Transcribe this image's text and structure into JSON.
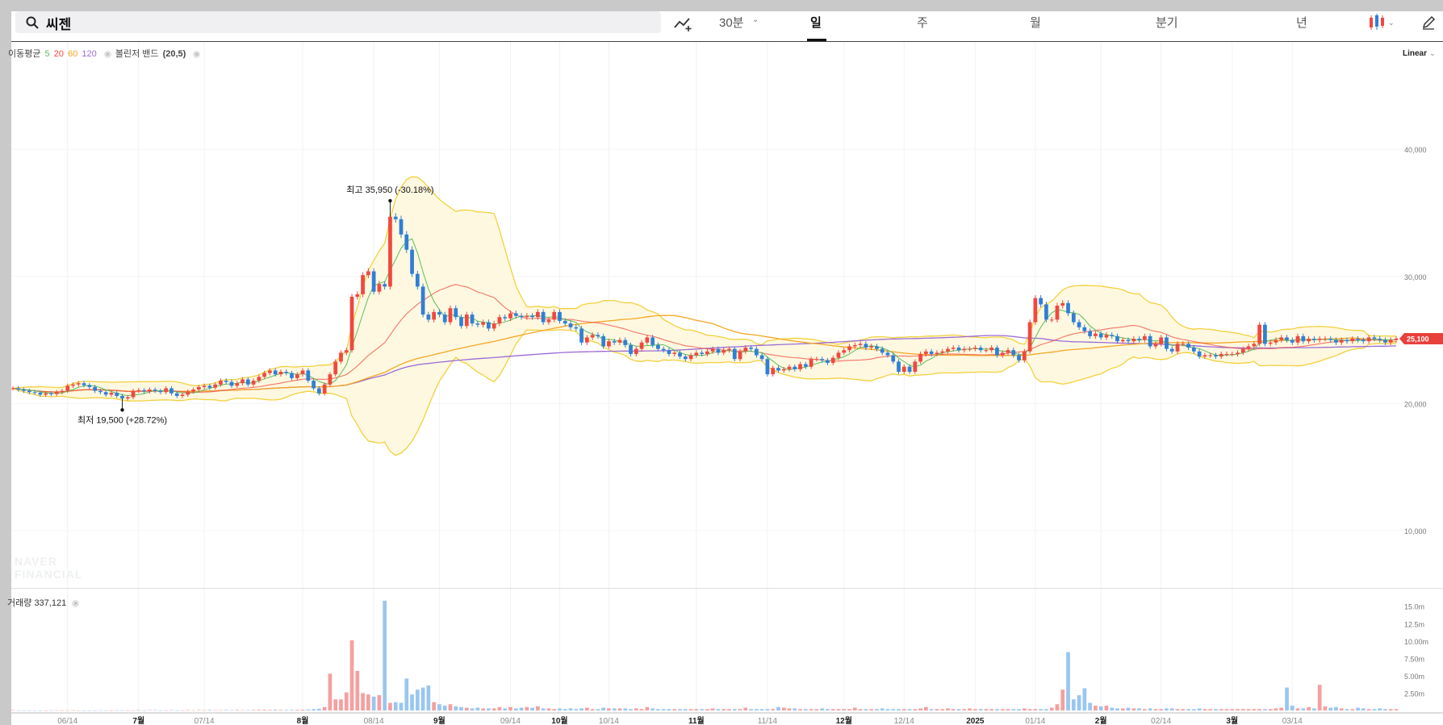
{
  "search": {
    "query": "씨젠"
  },
  "toolbar": {
    "intervals": [
      "30분",
      "일",
      "주",
      "월",
      "분기",
      "년"
    ],
    "active_interval": "일"
  },
  "indicators": {
    "ma_label": "이동평균",
    "ma_periods": [
      "5",
      "20",
      "60",
      "120"
    ],
    "bb_label": "볼린저 밴드",
    "bb_params": "(20,5)"
  },
  "scale_label": "Linear",
  "watermark": [
    "NAVER",
    "FINANCIAL"
  ],
  "volume": {
    "label": "거래량",
    "value": "337,121"
  },
  "colors": {
    "up": "#f0483e",
    "down": "#2f7fd6",
    "up_vol": "#f4a0a0",
    "down_vol": "#9ac6f0",
    "ma5": "#5bbf5b",
    "ma20": "#f0483e",
    "ma60": "#f5a623",
    "ma120": "#9b6bd6",
    "bb_line": "#f2d13e",
    "bb_fill": "#fff8e0",
    "price_tag": "#e8413c"
  },
  "chart_data": [
    {
      "type": "candlestick",
      "x_labels": [
        "06/14",
        "7월",
        "07/14",
        "8월",
        "08/14",
        "9월",
        "09/14",
        "10월",
        "10/14",
        "11월",
        "11/14",
        "12월",
        "12/14",
        "2025",
        "01/14",
        "2월",
        "02/14",
        "3월",
        "03/14"
      ],
      "y_ticks": [
        "10,000",
        "20,000",
        "30,000",
        "40,000"
      ],
      "ylim": [
        5500,
        48000
      ],
      "last_price": "25,100",
      "annotations": {
        "high": {
          "label": "최고 35,950 (-30.18%)",
          "value": 35950
        },
        "low": {
          "label": "최저 19,500 (+28.72%)",
          "value": 19500
        }
      },
      "close": [
        21200,
        21100,
        21000,
        20900,
        20850,
        20700,
        20800,
        20750,
        20900,
        21000,
        21400,
        21500,
        21600,
        21450,
        21300,
        21000,
        20900,
        20700,
        20850,
        20600,
        20400,
        20500,
        21000,
        21050,
        20950,
        21100,
        21000,
        20900,
        21200,
        20800,
        20600,
        20700,
        20950,
        21100,
        21300,
        21400,
        21250,
        21500,
        21800,
        21700,
        21400,
        21600,
        21900,
        21500,
        21800,
        22100,
        22400,
        22600,
        22300,
        22500,
        22400,
        22000,
        22300,
        22600,
        21800,
        21200,
        20800,
        21500,
        22300,
        23300,
        24000,
        24200,
        28400,
        28600,
        30100,
        30400,
        28800,
        29400,
        29200,
        34700,
        34500,
        33300,
        32100,
        30200,
        29200,
        27000,
        26600,
        27200,
        27000,
        26400,
        27500,
        26800,
        26100,
        27000,
        26300,
        26200,
        26400,
        25900,
        26300,
        26800,
        26700,
        27100,
        26900,
        26800,
        26900,
        26800,
        27200,
        26400,
        26600,
        27200,
        26500,
        26300,
        26000,
        25900,
        24800,
        25200,
        25400,
        25300,
        24500,
        24900,
        24800,
        25000,
        24600,
        23900,
        24300,
        24800,
        25200,
        24600,
        24300,
        24200,
        23900,
        24000,
        23700,
        23500,
        23800,
        24000,
        23900,
        24100,
        24300,
        24000,
        24200,
        24300,
        23500,
        24100,
        24400,
        24300,
        23800,
        23500,
        22300,
        22800,
        22600,
        22700,
        22900,
        22700,
        23100,
        22900,
        23500,
        23500,
        23400,
        23200,
        23600,
        24000,
        24200,
        24500,
        24600,
        24700,
        24400,
        24500,
        24300,
        24000,
        23800,
        23300,
        22500,
        22900,
        22500,
        23300,
        23900,
        24100,
        23900,
        24000,
        24100,
        24300,
        24400,
        24200,
        24300,
        24300,
        24400,
        24200,
        24200,
        24400,
        23800,
        24000,
        24200,
        23800,
        23400,
        24100,
        26400,
        28300,
        27800,
        26600,
        26600,
        27700,
        27900,
        27100,
        26400,
        26000,
        25700,
        25300,
        25500,
        25200,
        25400,
        25300,
        24900,
        25000,
        24900,
        25100,
        25000,
        25300,
        24500,
        24700,
        25200,
        24300,
        24100,
        24700,
        24700,
        24400,
        24100,
        23700,
        23800,
        23800,
        23700,
        23900,
        23900,
        23900,
        24000,
        24300,
        24500,
        24700,
        26200,
        24700,
        24800,
        25000,
        25200,
        25000,
        24800,
        25300,
        24900,
        25100,
        25000,
        25100,
        25100,
        25000,
        24800,
        25000,
        24900,
        25100,
        25000,
        24900,
        25200,
        25100,
        25000,
        24800,
        25000,
        25100
      ],
      "volume": [
        0.05,
        0.02,
        0.03,
        0.02,
        0.02,
        0.01,
        0.02,
        0.03,
        0.05,
        0.03,
        0.03,
        0.05,
        0.02,
        0.02,
        0.01,
        0.02,
        0.03,
        0.02,
        0.02,
        0.03,
        0.03,
        0.02,
        0.03,
        0.05,
        0.02,
        0.05,
        0.05,
        0.02,
        0.03,
        0.05,
        0.02,
        0.03,
        0.06,
        0.03,
        0.06,
        0.04,
        0.08,
        0.05,
        0.04,
        0.07,
        0.05,
        0.08,
        0.05,
        0.05,
        0.07,
        0.09,
        0.1,
        0.08,
        0.12,
        0.09,
        0.08,
        0.09,
        0.1,
        0.12,
        0.15,
        0.2,
        0.25,
        0.5,
        5.3,
        1.6,
        1.6,
        2.6,
        10.1,
        5.7,
        2.5,
        2.3,
        2.0,
        2.2,
        15.8,
        1.1,
        1.2,
        1.1,
        4.6,
        2.3,
        3.0,
        3.3,
        3.6,
        1.2,
        0.9,
        0.7,
        0.9,
        0.6,
        0.5,
        0.4,
        0.3,
        0.4,
        0.3,
        0.3,
        0.3,
        0.5,
        0.3,
        0.5,
        0.3,
        0.4,
        0.5,
        0.4,
        0.6,
        0.3,
        0.3,
        0.2,
        0.3,
        0.2,
        0.3,
        0.2,
        0.3,
        0.4,
        0.2,
        0.2,
        0.4,
        0.3,
        0.3,
        0.3,
        0.3,
        0.2,
        0.3,
        0.2,
        0.5,
        0.3,
        0.2,
        0.2,
        0.2,
        0.2,
        0.2,
        0.2,
        0.2,
        0.2,
        0.2,
        0.2,
        0.3,
        0.2,
        0.2,
        0.2,
        0.2,
        0.2,
        0.4,
        0.2,
        0.2,
        0.2,
        0.2,
        0.2,
        0.5,
        0.4,
        0.3,
        0.3,
        0.2,
        0.2,
        0.2,
        0.2,
        0.3,
        0.2,
        0.2,
        0.2,
        0.2,
        0.2,
        0.4,
        0.2,
        0.2,
        0.2,
        0.2,
        0.3,
        0.2,
        0.2,
        0.2,
        0.2,
        0.2,
        0.2,
        0.3,
        0.5,
        0.2,
        0.2,
        0.2,
        0.3,
        0.2,
        0.2,
        0.2,
        0.3,
        0.2,
        0.2,
        0.2,
        0.2,
        0.2,
        0.2,
        0.2,
        0.2,
        0.2,
        0.3,
        0.2,
        0.2,
        0.2,
        0.2,
        0.4,
        0.9,
        3.0,
        8.4,
        1.6,
        2.2,
        3.2,
        1.1,
        0.7,
        0.6,
        0.7,
        0.4,
        0.3,
        0.3,
        0.4,
        0.3,
        0.3,
        0.2,
        0.3,
        0.2,
        0.2,
        0.3,
        0.3,
        0.2,
        0.2,
        0.2,
        0.2,
        0.3,
        0.2,
        0.2,
        0.2,
        0.2,
        0.2,
        0.2,
        0.2,
        0.2,
        0.2,
        0.2,
        0.2,
        0.2,
        0.2,
        0.3,
        0.4,
        3.3,
        0.7,
        0.3,
        0.3,
        0.5,
        0.3,
        3.7,
        0.6,
        0.4,
        0.5,
        0.3,
        0.2,
        0.2,
        0.4,
        0.3,
        0.2,
        0.2,
        0.3,
        0.2,
        0.2,
        0.2,
        0.2,
        0.2,
        0.2,
        0.2,
        0.3
      ],
      "volume_ticks": [
        "2.50m",
        "5.00m",
        "7.50m",
        "10.00m",
        "12.5m",
        "15.0m"
      ],
      "volume_unit": "m"
    }
  ]
}
